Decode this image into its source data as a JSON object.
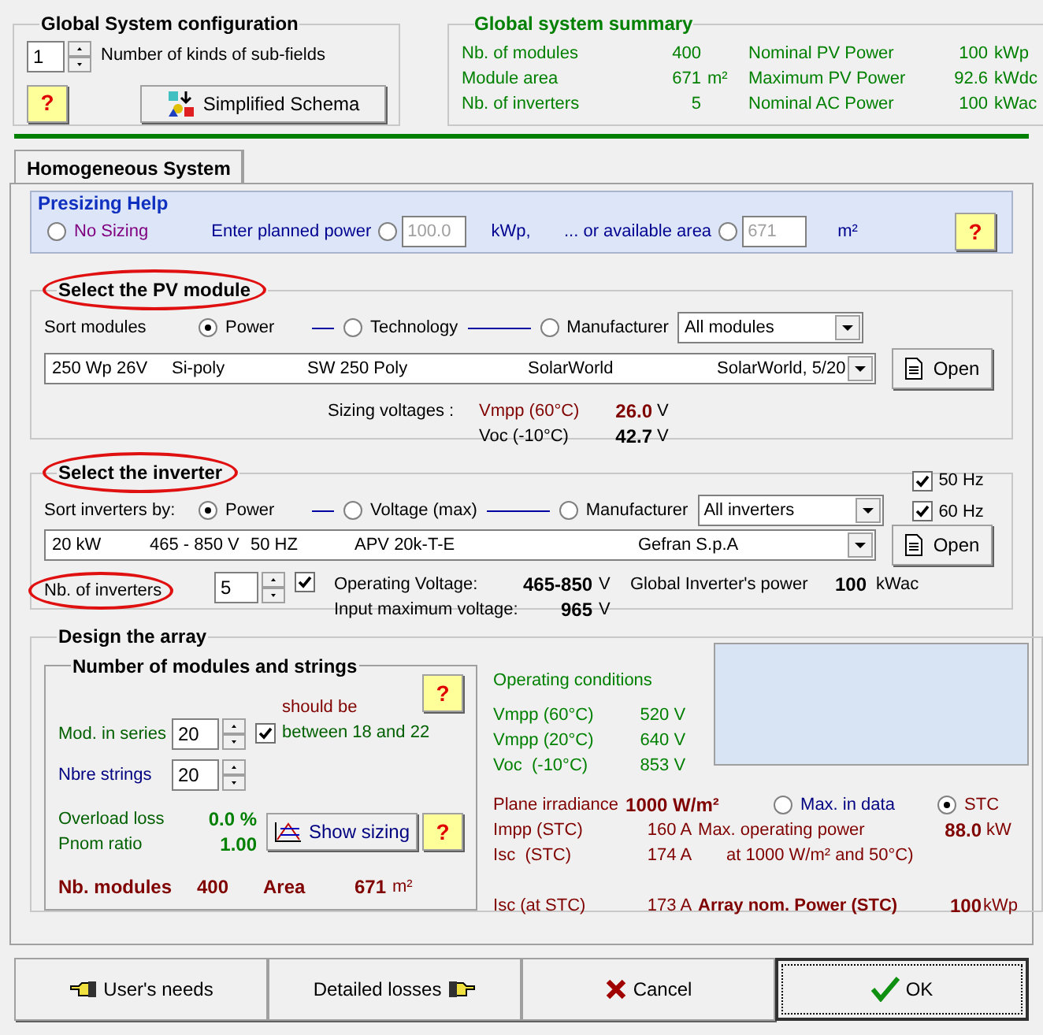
{
  "global_config": {
    "title": "Global System configuration",
    "subfields": {
      "value": "1",
      "label": "Number of kinds of sub-fields"
    },
    "help": "?",
    "schema_button": "Simplified Schema"
  },
  "summary": {
    "title": "Global system summary",
    "items": [
      {
        "label": "Nb. of modules",
        "value": "400"
      },
      {
        "label": "Nominal PV Power",
        "value": "100",
        "unit": "kWp"
      },
      {
        "label": "Module area",
        "value": "671",
        "unit": "m²"
      },
      {
        "label": "Maximum PV Power",
        "value": "92.6",
        "unit": "kWdc"
      },
      {
        "label": "Nb. of inverters",
        "value": "5"
      },
      {
        "label": "Nominal AC Power",
        "value": "100",
        "unit": "kWac"
      }
    ]
  },
  "tab": {
    "label": "Homogeneous System",
    "selected": true
  },
  "presizing": {
    "title": "Presizing Help",
    "help": "?",
    "options": [
      {
        "kind": "plain",
        "label": "No Sizing",
        "selected": false
      },
      {
        "kind": "input",
        "label": "Enter planned power",
        "selected": false,
        "disabled": true,
        "value": "100.0",
        "unit": "kWp,"
      },
      {
        "kind": "input",
        "label": "... or available area",
        "selected": false,
        "disabled": true,
        "value": "671",
        "unit": "m²"
      }
    ]
  },
  "pv_module": {
    "title": "Select the PV module",
    "circled": true,
    "sort_label": "Sort modules",
    "sort_options": [
      {
        "label": "Power",
        "selected": true
      },
      {
        "label": "Technology",
        "selected": false
      },
      {
        "label": "Manufacturer",
        "selected": false
      }
    ],
    "filter": "All modules",
    "selection": [
      "250 Wp 26V",
      "Si-poly",
      "SW 250 Poly",
      "SolarWorld",
      "SolarWorld, 5/20"
    ],
    "open_button": "Open",
    "sizing_label": "Sizing voltages :",
    "voltages": [
      {
        "label": "Vmpp (60°C)",
        "value": "26.0",
        "unit": "V"
      },
      {
        "label": "Voc (-10°C)",
        "value": "42.7",
        "unit": "V"
      }
    ]
  },
  "inverter": {
    "title": "Select the inverter",
    "circled": true,
    "sort_label": "Sort inverters by:",
    "sort_options": [
      {
        "label": "Power",
        "selected": true
      },
      {
        "label": "Voltage (max)",
        "selected": false
      },
      {
        "label": "Manufacturer",
        "selected": false
      }
    ],
    "filter": "All inverters",
    "frequencies": [
      {
        "label": "50 Hz",
        "checked": true
      },
      {
        "label": "60 Hz",
        "checked": true
      }
    ],
    "selection": [
      "20 kW",
      "465 - 850 V",
      "50 HZ",
      "APV 20k-T-E",
      "Gefran S.p.A"
    ],
    "open_button": "Open",
    "count": {
      "label": "Nb. of inverters",
      "circled": true,
      "value": "5",
      "checked": true
    },
    "info": [
      {
        "label": "Operating Voltage:",
        "value": "465-850",
        "unit": "V"
      },
      {
        "label": "Input maximum voltage:",
        "value": "965",
        "unit": "V"
      }
    ],
    "global_power": {
      "label": "Global Inverter's power",
      "value": "100",
      "unit": "kWac"
    }
  },
  "array": {
    "title": "Design the array",
    "strings_title": "Number of modules and strings",
    "help": "?",
    "series": {
      "label": "Mod. in series",
      "value": "20"
    },
    "strings": {
      "label": "Nbre strings",
      "value": "20"
    },
    "advice": {
      "label": "should be",
      "range": "between 18 and 22",
      "checked": true
    },
    "ratios": [
      {
        "label": "Overload loss",
        "value": "0.0 %"
      },
      {
        "label": "Pnom ratio",
        "value": "1.00"
      }
    ],
    "show_sizing": "Show sizing",
    "sizing_help": "?",
    "totals": [
      {
        "label": "Nb. modules",
        "value": "400"
      },
      {
        "label": "Area",
        "value": "671",
        "unit": "m²"
      }
    ],
    "conditions_title": "Operating conditions",
    "conditions": [
      {
        "label": "Vmpp (60°C)",
        "value": "520 V"
      },
      {
        "label": "Vmpp (20°C)",
        "value": "640 V"
      },
      {
        "label": "Voc  (-10°C)",
        "value": "853 V"
      }
    ],
    "irradiance": {
      "label": "Plane irradiance",
      "value": "1000 W/m²",
      "options": [
        {
          "label": "Max. in data",
          "selected": false
        },
        {
          "label": "STC",
          "selected": true
        }
      ]
    },
    "currents": [
      {
        "label": "Impp (STC)",
        "value": "160 A"
      },
      {
        "label": "Isc  (STC)",
        "value": "174 A"
      },
      {
        "label": "Isc (at STC)",
        "value": "173 A"
      }
    ],
    "max_power": {
      "label": "Max. operating power",
      "value": "88.0",
      "unit": "kW",
      "note": "at 1000 W/m² and 50°C)"
    },
    "nominal_power": {
      "label": "Array nom. Power (STC)",
      "value": "100",
      "unit": "kWp"
    }
  },
  "buttons": [
    {
      "label": "User's needs",
      "kind": "back"
    },
    {
      "label": "Detailed losses",
      "kind": "forward"
    },
    {
      "label": "Cancel",
      "kind": "cancel"
    },
    {
      "label": "OK",
      "kind": "ok"
    }
  ]
}
